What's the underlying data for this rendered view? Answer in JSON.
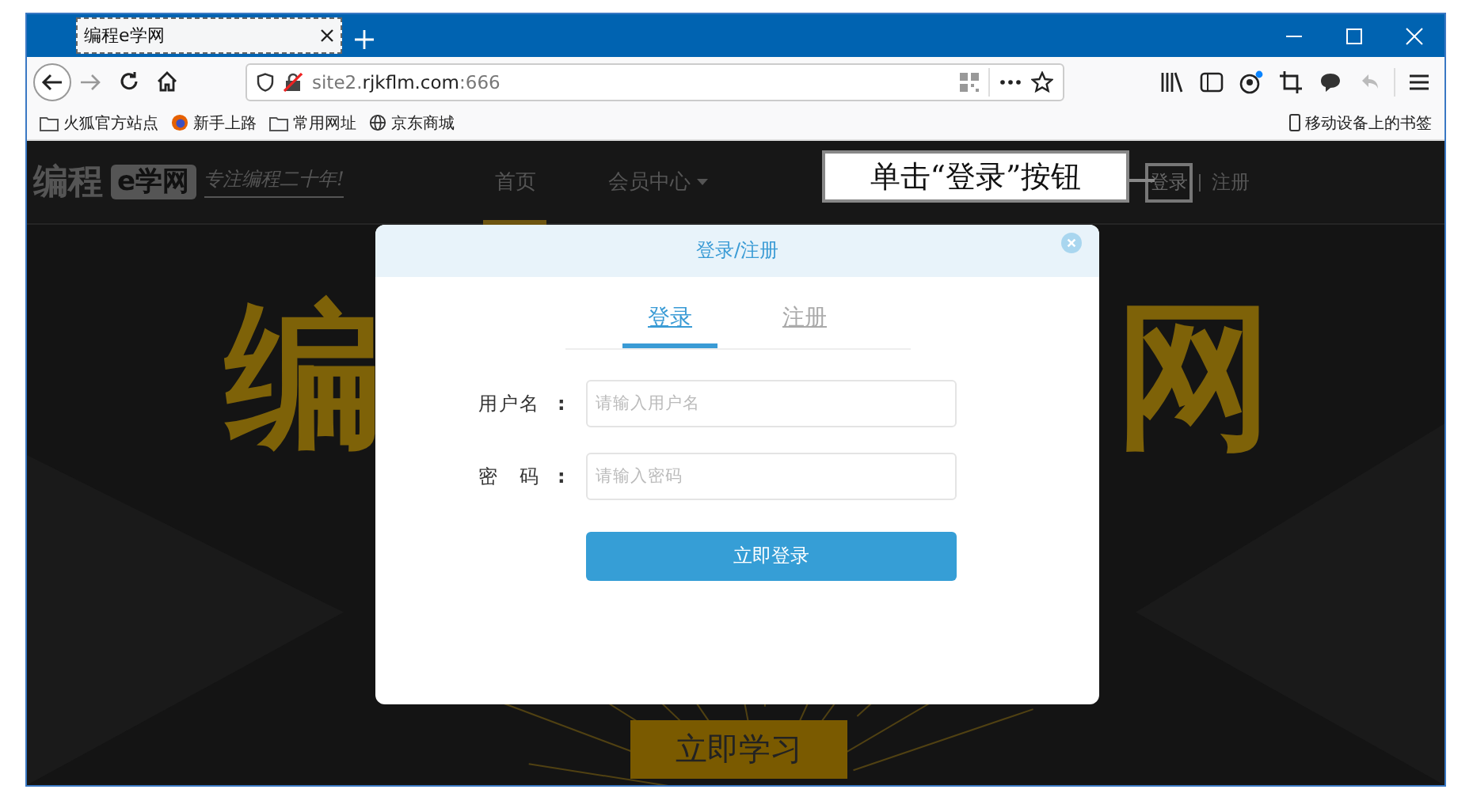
{
  "browser": {
    "tab": {
      "title": "编程e学网"
    },
    "url": "site2.**rjkflm.com**:666",
    "bookmarks": [
      {
        "label": "火狐官方站点",
        "kind": "folder"
      },
      {
        "label": "新手上路",
        "kind": "firefox"
      },
      {
        "label": "常用网址",
        "kind": "folder"
      },
      {
        "label": "京东商城",
        "kind": "globe"
      }
    ],
    "mobile_bookmarks": "移动设备上的书签"
  },
  "site": {
    "logo": {
      "name": "编程",
      "badge": "e学网",
      "slogan": "专注编程二十年!"
    },
    "nav": [
      {
        "label": "首页",
        "selected": true,
        "dropdown": false
      },
      {
        "label": "会员中心",
        "selected": false,
        "dropdown": true
      }
    ],
    "auth_links": [
      "登录",
      "注册"
    ],
    "banner": {
      "left_char": "编",
      "right_char": "网",
      "button": "立即学习"
    }
  },
  "callout": {
    "text": "单击“登录”按钮"
  },
  "modal": {
    "title": "登录/注册",
    "tabs": [
      {
        "label": "登录",
        "selected": true
      },
      {
        "label": "注册",
        "selected": false
      }
    ],
    "fields": [
      {
        "label": "用户名",
        "colon": ":",
        "placeholder": "请输入用户名"
      },
      {
        "label": "密码",
        "colon": ":",
        "placeholder": "请输入密码"
      }
    ],
    "submit": "立即登录"
  }
}
